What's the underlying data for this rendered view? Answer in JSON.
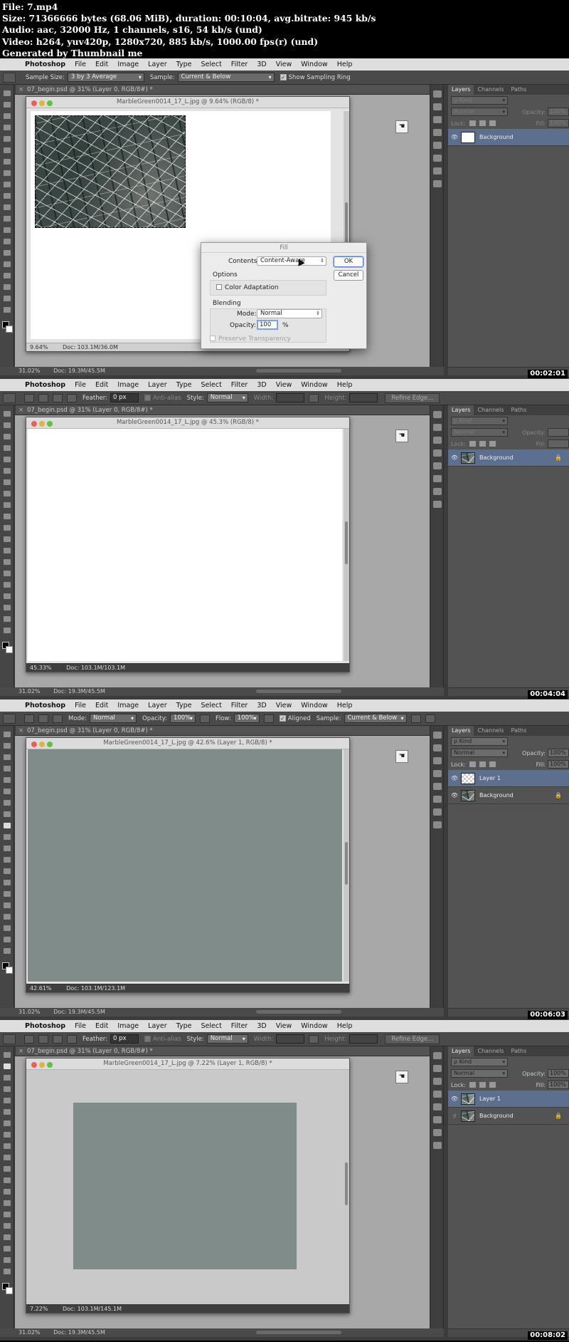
{
  "header": {
    "lines": [
      "File: 7.mp4",
      "Size: 71366666 bytes (68.06 MiB), duration: 00:10:04, avg.bitrate: 945 kb/s",
      "Audio: aac, 32000 Hz, 1 channels, s16, 54 kb/s (und)",
      "Video: h264, yuv420p, 1280x720, 885 kb/s, 1000.00 fps(r) (und)",
      "Generated by Thumbnail me"
    ]
  },
  "menu": {
    "app": "Photoshop",
    "items": [
      "File",
      "Edit",
      "Image",
      "Layer",
      "Type",
      "Select",
      "Filter",
      "3D",
      "View",
      "Window",
      "Help"
    ]
  },
  "panel_tabs": [
    "Layers",
    "Channels",
    "Paths"
  ],
  "panel_labels": {
    "kind": "ρ Kind",
    "opacity": "Opacity:",
    "lock": "Lock:",
    "fill": "Fill:"
  },
  "frames": [
    {
      "timestamp": "00:02:01",
      "options": {
        "sample_size_label": "Sample Size:",
        "sample_size_value": "3 by 3 Average",
        "sample_label": "Sample:",
        "sample_value": "Current & Below",
        "ring_label": "Show Sampling Ring"
      },
      "doc_tab": "07_begin.psd @ 31% (Layer 0, RGB/8#) *",
      "window_title": "MarbleGreen0014_17_L.jpg @ 9.64% (RGB/8) *",
      "window_zoom": "9.64%",
      "window_doc": "Doc: 103.1M/36.0M",
      "status_zoom": "31.02%",
      "status_doc": "Doc: 19.3M/45.5M",
      "blend_mode": "Normal",
      "opacity": "100%",
      "fill": "100%",
      "layers": [
        {
          "name": "Background",
          "locked": false
        }
      ],
      "dialog": {
        "title": "Fill",
        "contents_label": "Contents:",
        "contents_value": "Content-Aware",
        "ok": "OK",
        "cancel": "Cancel",
        "options_label": "Options",
        "color_adaptation": "Color Adaptation",
        "blending_label": "Blending",
        "mode_label": "Mode:",
        "mode_value": "Normal",
        "opacity_label": "Opacity:",
        "opacity_value": "100",
        "percent": "%",
        "preserve": "Preserve Transparency"
      }
    },
    {
      "timestamp": "00:04:04",
      "options": {
        "feather_label": "Feather:",
        "feather_value": "0 px",
        "antialias": "Anti-alias",
        "style_label": "Style:",
        "style_value": "Normal",
        "width_label": "Width:",
        "height_label": "Height:",
        "refine": "Refine Edge..."
      },
      "doc_tab": "07_begin.psd @ 31% (Layer 0, RGB/8#) *",
      "window_title": "MarbleGreen0014_17_L.jpg @ 45.3% (RGB/8) *",
      "window_zoom": "45.33%",
      "window_doc": "Doc: 103.1M/103.1M",
      "status_zoom": "31.02%",
      "status_doc": "Doc: 19.3M/45.5M",
      "blend_mode": "Normal",
      "opacity": "",
      "fill": "",
      "layers": [
        {
          "name": "Background",
          "locked": true
        }
      ]
    },
    {
      "timestamp": "00:06:03",
      "options": {
        "mode_label": "Mode:",
        "mode_value": "Normal",
        "opacity_label": "Opacity:",
        "opacity_value": "100%",
        "flow_label": "Flow:",
        "flow_value": "100%",
        "aligned": "Aligned",
        "sample_label": "Sample:",
        "sample_value": "Current & Below"
      },
      "doc_tab": "07_begin.psd @ 31% (Layer 0, RGB/8#) *",
      "window_title": "MarbleGreen0014_17_L.jpg @ 42.6% (Layer 1, RGB/8) *",
      "window_zoom": "42.61%",
      "window_doc": "Doc: 103.1M/123.1M",
      "status_zoom": "31.02%",
      "status_doc": "Doc: 19.3M/45.5M",
      "blend_mode": "Normal",
      "opacity": "100%",
      "fill": "100%",
      "layers": [
        {
          "name": "Layer 1",
          "locked": false
        },
        {
          "name": "Background",
          "locked": true
        }
      ]
    },
    {
      "timestamp": "00:08:02",
      "options": {
        "feather_label": "Feather:",
        "feather_value": "0 px",
        "antialias": "Anti-alias",
        "style_label": "Style:",
        "style_value": "Normal",
        "width_label": "Width:",
        "height_label": "Height:",
        "refine": "Refine Edge..."
      },
      "doc_tab": "07_begin.psd @ 31% (Layer 0, RGB/8#) *",
      "window_title": "MarbleGreen0014_17_L.jpg @ 7.22% (Layer 1, RGB/8) *",
      "window_zoom": "7.22%",
      "window_doc": "Doc: 103.1M/145.1M",
      "status_zoom": "31.02%",
      "status_doc": "Doc: 19.3M/45.5M",
      "blend_mode": "Normal",
      "opacity": "100%",
      "fill": "100%",
      "layers": [
        {
          "name": "Layer 1",
          "locked": false
        },
        {
          "name": "Background",
          "locked": true
        }
      ]
    }
  ]
}
